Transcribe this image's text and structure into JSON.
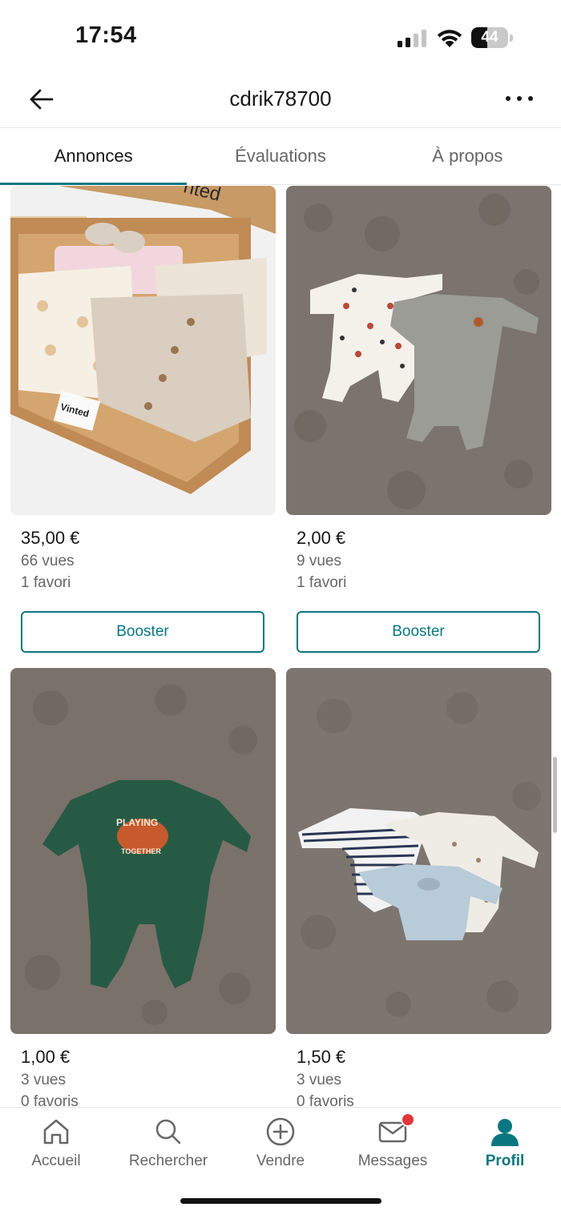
{
  "status": {
    "time": "17:54",
    "battery": "44",
    "battery_level": 0.44
  },
  "header": {
    "title": "cdrik78700"
  },
  "tabs": [
    {
      "label": "Annonces",
      "active": true
    },
    {
      "label": "Évaluations",
      "active": false
    },
    {
      "label": "À propos",
      "active": false
    }
  ],
  "items": [
    {
      "price": "35,00 €",
      "views": "66 vues",
      "favorites": "1 favori",
      "button": "Booster",
      "image": "box-of-baby-clothes"
    },
    {
      "price": "2,00 €",
      "views": "9 vues",
      "favorites": "1 favori",
      "button": "Booster",
      "image": "two-baby-pajamas-on-carpet"
    },
    {
      "price": "1,00 €",
      "views": "3 vues",
      "favorites": "0 favoris",
      "image": "green-baby-pajama"
    },
    {
      "price": "1,50 €",
      "views": "3 vues",
      "favorites": "0 favoris",
      "image": "three-baby-bodysuits"
    }
  ],
  "image_text": {
    "brand": "Vinted",
    "print_line1": "PLAYING",
    "print_line2": "TOGETHER"
  },
  "bottom_nav": [
    {
      "label": "Accueil",
      "icon": "home-icon",
      "active": false
    },
    {
      "label": "Rechercher",
      "icon": "search-icon",
      "active": false
    },
    {
      "label": "Vendre",
      "icon": "plus-circle-icon",
      "active": false
    },
    {
      "label": "Messages",
      "icon": "mail-icon",
      "active": false,
      "badge": true
    },
    {
      "label": "Profil",
      "icon": "profile-icon",
      "active": true
    }
  ],
  "colors": {
    "accent": "#09777f",
    "badge": "#e1363c",
    "text": "#171717",
    "muted": "#666666"
  }
}
